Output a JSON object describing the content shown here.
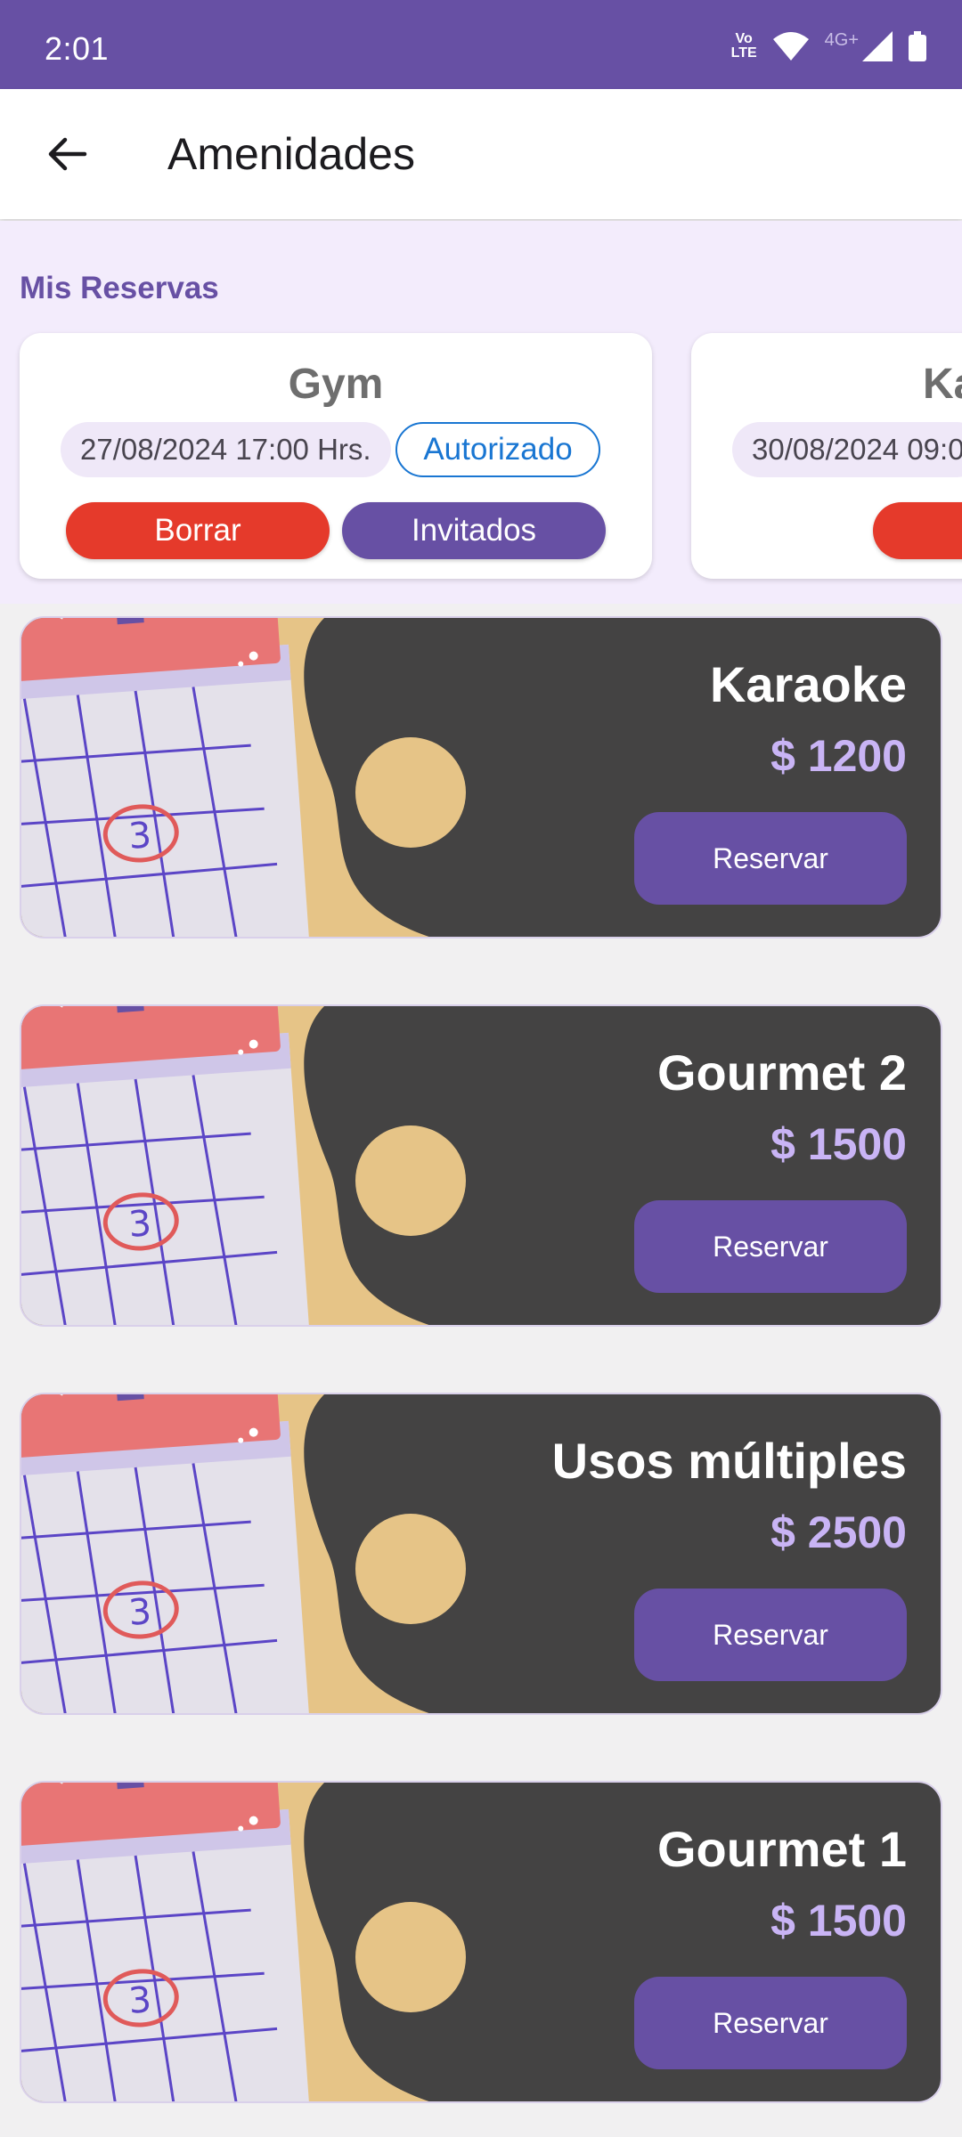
{
  "status_bar": {
    "time": "2:01",
    "volte": "Vo LTE",
    "network": "4G+"
  },
  "app_bar": {
    "title": "Amenidades"
  },
  "reservas": {
    "title": "Mis Reservas",
    "items": [
      {
        "name": "Gym",
        "date": "27/08/2024 17:00 Hrs.",
        "status": "Autorizado",
        "delete_label": "Borrar",
        "guests_label": "Invitados"
      },
      {
        "name": "Ka",
        "date": "30/08/2024 09:0"
      }
    ]
  },
  "amenities": [
    {
      "name": "Karaoke",
      "price": "$ 1200",
      "button": "Reservar"
    },
    {
      "name": "Gourmet 2",
      "price": "$ 1500",
      "button": "Reservar"
    },
    {
      "name": "Usos múltiples",
      "price": "$ 2500",
      "button": "Reservar"
    },
    {
      "name": "Gourmet 1",
      "price": "$ 1500",
      "button": "Reservar"
    }
  ],
  "colors": {
    "primary": "#6750a4",
    "danger": "#e53a2b",
    "card_dark": "#444343",
    "price": "#c9b4f5",
    "status_blue": "#1976d2"
  }
}
